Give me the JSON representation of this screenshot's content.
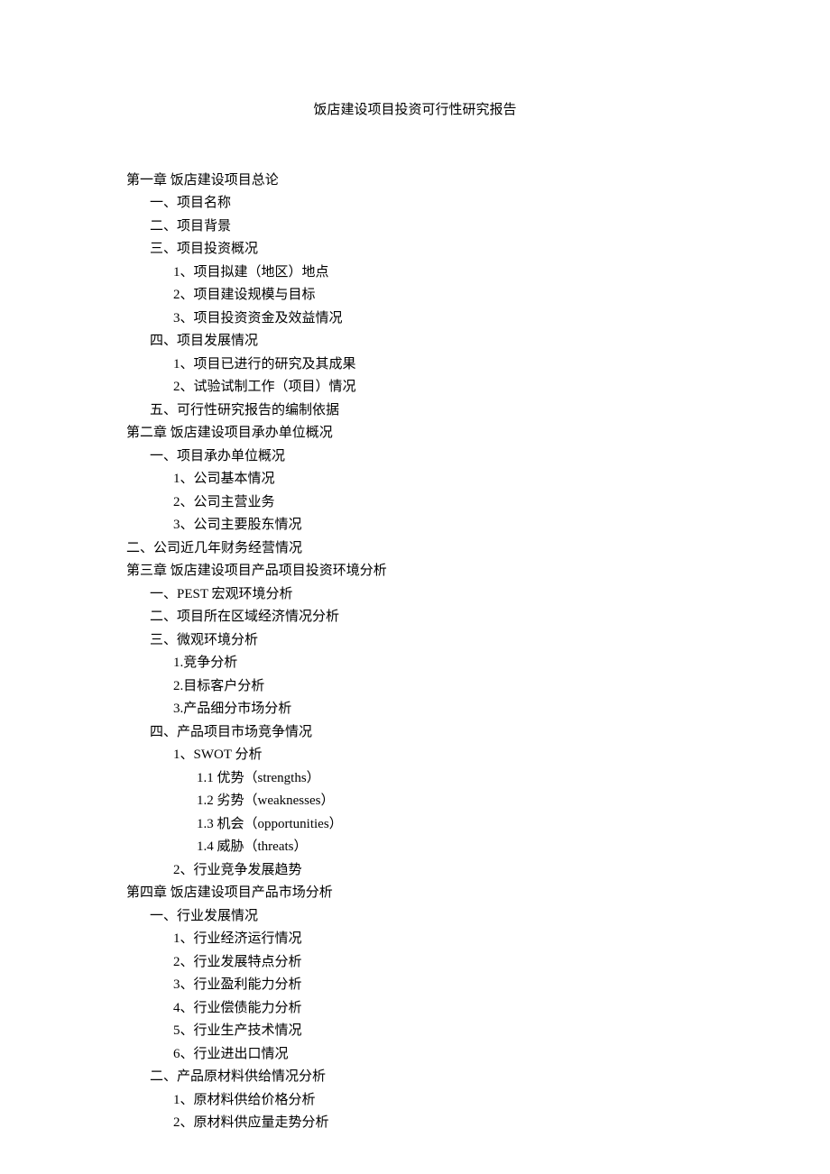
{
  "title": "饭店建设项目投资可行性研究报告",
  "lines": [
    {
      "indent": 0,
      "text": "第一章 饭店建设项目总论"
    },
    {
      "indent": 1,
      "text": "一、项目名称"
    },
    {
      "indent": 1,
      "text": "二、项目背景"
    },
    {
      "indent": 1,
      "text": "三、项目投资概况"
    },
    {
      "indent": 2,
      "text": "1、项目拟建（地区）地点"
    },
    {
      "indent": 2,
      "text": "2、项目建设规模与目标"
    },
    {
      "indent": 2,
      "text": "3、项目投资资金及效益情况"
    },
    {
      "indent": 1,
      "text": "四、项目发展情况"
    },
    {
      "indent": 2,
      "text": "1、项目已进行的研究及其成果"
    },
    {
      "indent": 2,
      "text": "2、试验试制工作（项目）情况"
    },
    {
      "indent": 1,
      "text": "五、可行性研究报告的编制依据"
    },
    {
      "indent": 0,
      "text": "第二章 饭店建设项目承办单位概况"
    },
    {
      "indent": 1,
      "text": "一、项目承办单位概况"
    },
    {
      "indent": 2,
      "text": "1、公司基本情况"
    },
    {
      "indent": 2,
      "text": "2、公司主营业务"
    },
    {
      "indent": 2,
      "text": "3、公司主要股东情况"
    },
    {
      "indent": 0,
      "text": "二、公司近几年财务经营情况"
    },
    {
      "indent": 0,
      "text": "第三章 饭店建设项目产品项目投资环境分析"
    },
    {
      "indent": 1,
      "text": "一、PEST 宏观环境分析"
    },
    {
      "indent": 1,
      "text": "二、项目所在区域经济情况分析"
    },
    {
      "indent": 1,
      "text": "三、微观环境分析"
    },
    {
      "indent": 2,
      "text": "1.竞争分析"
    },
    {
      "indent": 2,
      "text": "2.目标客户分析"
    },
    {
      "indent": 2,
      "text": "3.产品细分市场分析"
    },
    {
      "indent": 1,
      "text": "四、产品项目市场竞争情况"
    },
    {
      "indent": 2,
      "text": "1、SWOT 分析"
    },
    {
      "indent": 3,
      "text": "1.1 优势（strengths）"
    },
    {
      "indent": 3,
      "text": "1.2 劣势（weaknesses）"
    },
    {
      "indent": 3,
      "text": "1.3 机会（opportunities）"
    },
    {
      "indent": 3,
      "text": "1.4 威胁（threats）"
    },
    {
      "indent": 2,
      "text": "2、行业竞争发展趋势"
    },
    {
      "indent": 0,
      "text": "第四章 饭店建设项目产品市场分析"
    },
    {
      "indent": 1,
      "text": "一、行业发展情况"
    },
    {
      "indent": 2,
      "text": "1、行业经济运行情况"
    },
    {
      "indent": 2,
      "text": "2、行业发展特点分析"
    },
    {
      "indent": 2,
      "text": "3、行业盈利能力分析"
    },
    {
      "indent": 2,
      "text": "4、行业偿债能力分析"
    },
    {
      "indent": 2,
      "text": "5、行业生产技术情况"
    },
    {
      "indent": 2,
      "text": "6、行业进出口情况"
    },
    {
      "indent": 1,
      "text": "二、产品原材料供给情况分析"
    },
    {
      "indent": 2,
      "text": "1、原材料供给价格分析"
    },
    {
      "indent": 2,
      "text": "2、原材料供应量走势分析"
    }
  ]
}
